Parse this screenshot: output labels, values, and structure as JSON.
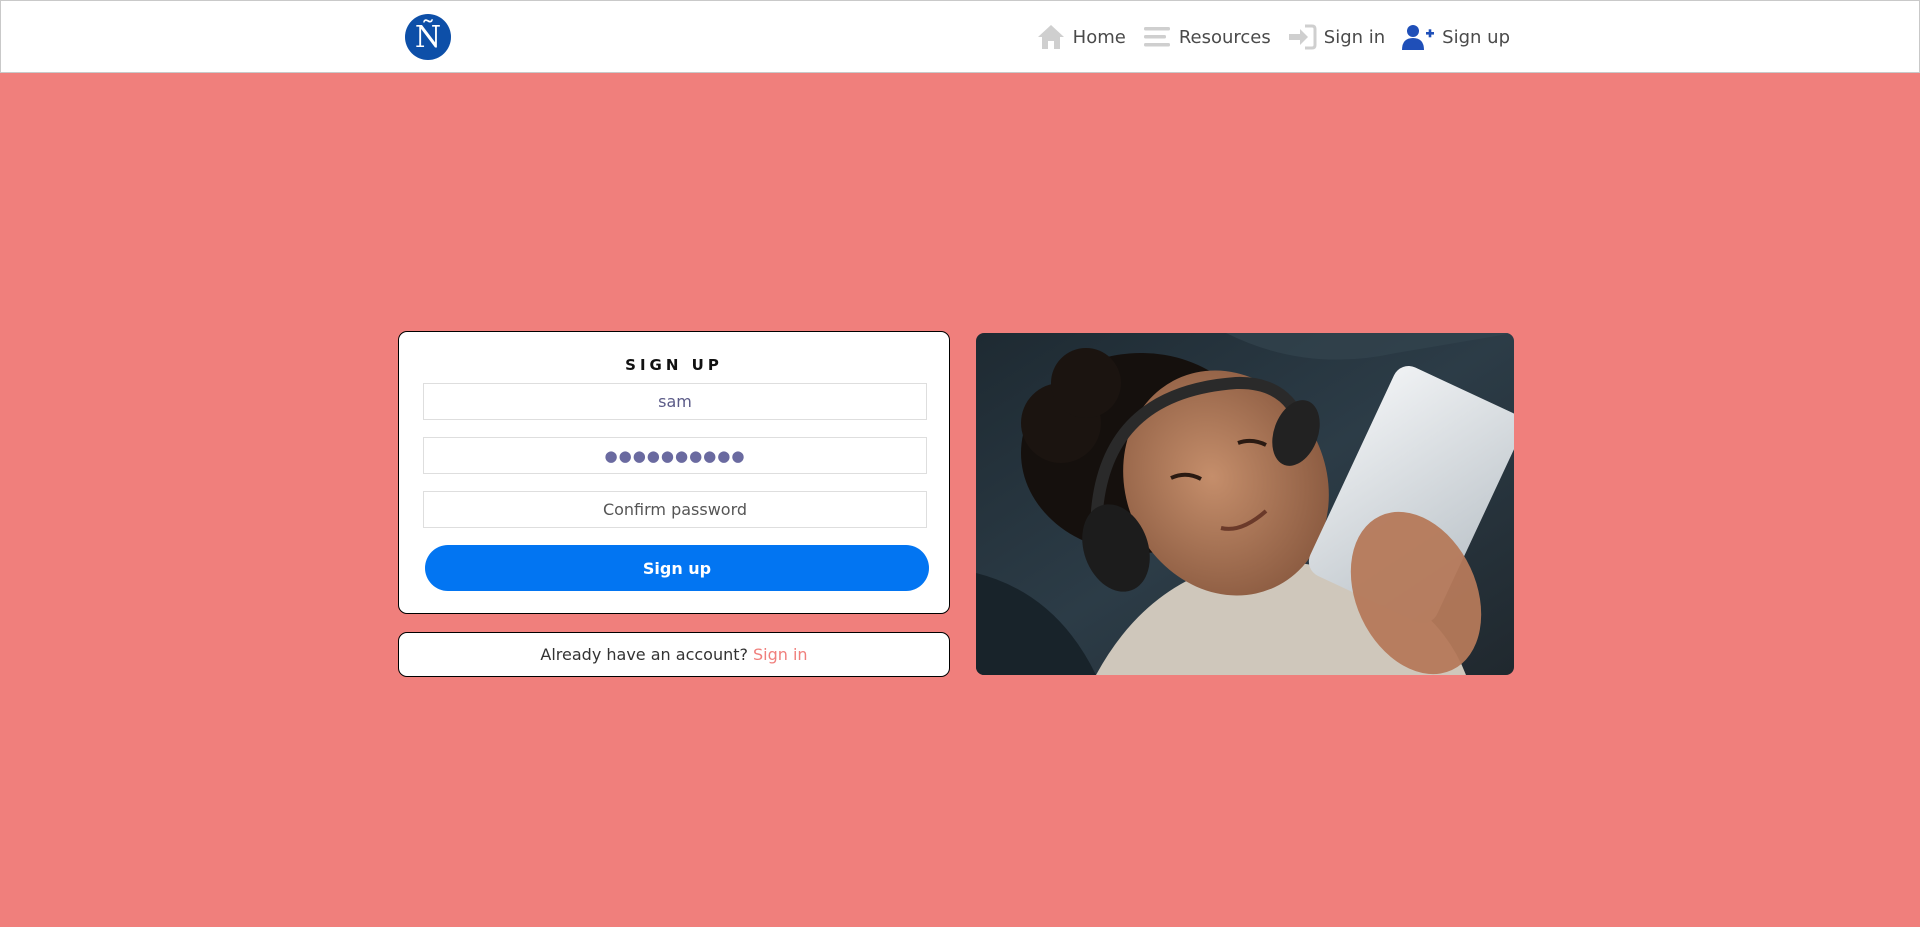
{
  "navbar": {
    "logo_letter": "Ñ",
    "items": [
      {
        "icon": "home-icon",
        "label": "Home"
      },
      {
        "icon": "list-icon",
        "label": "Resources"
      },
      {
        "icon": "sign-in-icon",
        "label": "Sign in"
      },
      {
        "icon": "user-plus-icon",
        "label": "Sign up"
      }
    ]
  },
  "signup_form": {
    "title": "SIGN UP",
    "username_value": "sam",
    "password_value": "●●●●●●●●●●",
    "confirm_placeholder": "Confirm password",
    "submit_label": "Sign up"
  },
  "login_prompt": {
    "text": "Already have an account?",
    "link_label": "Sign in"
  },
  "colors": {
    "background": "#f07f7c",
    "primary_button": "#0275f2",
    "logo": "#0d4fa8",
    "nav_icon_gray": "#cfcfcf",
    "nav_icon_active": "#1f4fb8"
  }
}
